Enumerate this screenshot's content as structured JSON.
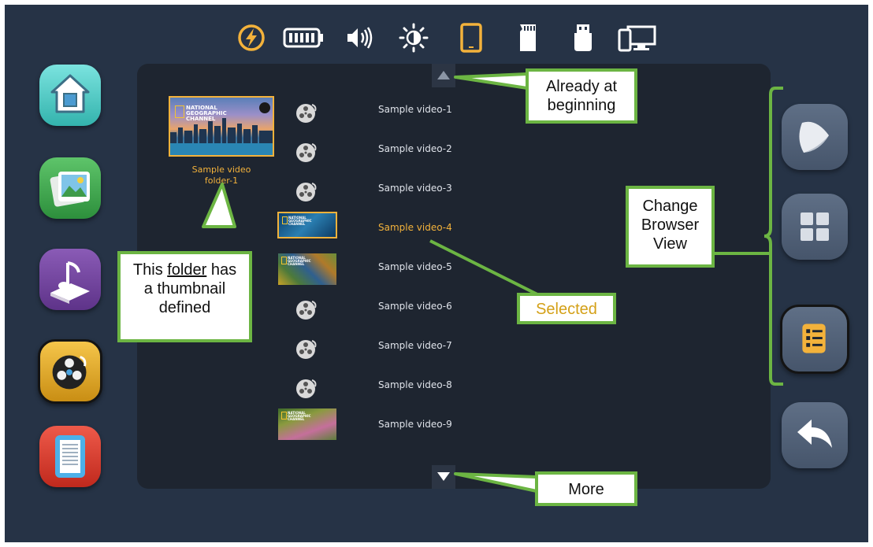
{
  "status_bar": {
    "icons": [
      "flash-icon",
      "battery-icon",
      "volume-icon",
      "brightness-icon",
      "tablet-icon",
      "sd-card-icon",
      "usb-drive-icon",
      "display-icon"
    ]
  },
  "sidebar": {
    "items": [
      {
        "name": "home",
        "icon": "home-icon"
      },
      {
        "name": "photos",
        "icon": "photo-icon"
      },
      {
        "name": "music",
        "icon": "music-icon"
      },
      {
        "name": "video",
        "icon": "film-reel-icon",
        "active": true
      },
      {
        "name": "documents",
        "icon": "document-icon"
      }
    ]
  },
  "browser": {
    "folder": {
      "label_line1": "Sample video",
      "label_line2": "folder-1",
      "thumb_text": [
        "NATIONAL",
        "GEOGRAPHIC",
        "CHANNEL"
      ]
    },
    "items": [
      {
        "label": "Sample video-1",
        "thumb": "reel"
      },
      {
        "label": "Sample video-2",
        "thumb": "reel"
      },
      {
        "label": "Sample video-3",
        "thumb": "reel"
      },
      {
        "label": "Sample video-4",
        "thumb": "image",
        "selected": true
      },
      {
        "label": "Sample video-5",
        "thumb": "image"
      },
      {
        "label": "Sample video-6",
        "thumb": "reel"
      },
      {
        "label": "Sample video-7",
        "thumb": "reel"
      },
      {
        "label": "Sample video-8",
        "thumb": "reel"
      },
      {
        "label": "Sample video-9",
        "thumb": "image"
      }
    ],
    "scroll_up_icon": "triangle-up-icon",
    "scroll_down_icon": "triangle-down-icon"
  },
  "right_controls": {
    "buttons": [
      {
        "name": "play-view",
        "icon": "play-icon"
      },
      {
        "name": "grid-view",
        "icon": "grid-icon"
      },
      {
        "name": "list-view",
        "icon": "list-icon",
        "active": true
      },
      {
        "name": "back",
        "icon": "back-arrow-icon"
      }
    ]
  },
  "callouts": {
    "beginning": [
      "Already at",
      "beginning"
    ],
    "folder_pre": "This ",
    "folder_word": "folder",
    "folder_post": " has",
    "folder_line2": "a thumbnail",
    "folder_line3": "defined",
    "change_view": [
      "Change",
      "Browser",
      "View"
    ],
    "selected": "Selected",
    "more": "More"
  },
  "colors": {
    "accent": "#f3b23b",
    "callout_border": "#6cb543",
    "background": "#263346",
    "panel": "#1e2530"
  }
}
